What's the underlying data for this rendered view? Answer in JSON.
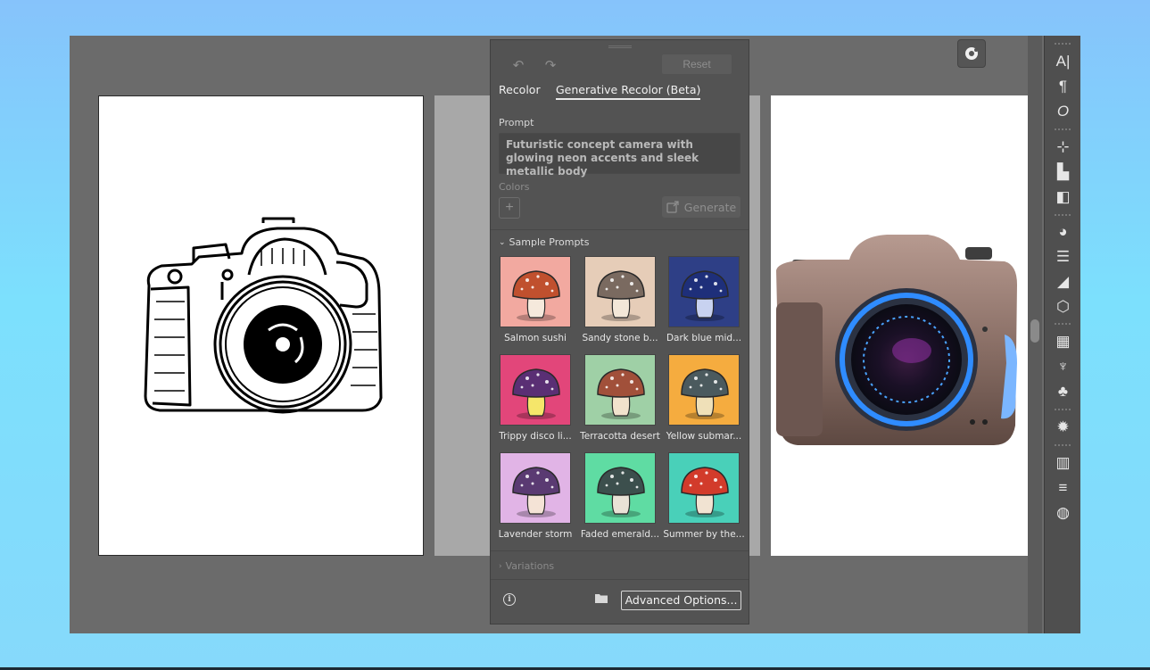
{
  "panel": {
    "reset_label": "Reset",
    "tabs": [
      {
        "label": "Recolor"
      },
      {
        "label": "Generative Recolor (Beta)"
      }
    ],
    "prompt_label": "Prompt",
    "prompt_value": "Futuristic concept camera with glowing neon accents and sleek metallic body",
    "colors_label": "Colors",
    "generate_label": "Generate",
    "sample_prompts_label": "Sample Prompts",
    "variations_label": "Variations",
    "advanced_label": "Advanced Options...",
    "info_glyph": "i",
    "samples": [
      {
        "label": "Salmon sushi",
        "bg": "#f2a9a0",
        "cap": "#c0502e",
        "stem": "#f5e9dc"
      },
      {
        "label": "Sandy stone b...",
        "bg": "#e6cdb8",
        "cap": "#7a6a60",
        "stem": "#f3e7d8"
      },
      {
        "label": "Dark blue mid...",
        "bg": "#2e3f86",
        "cap": "#1e2f7a",
        "stem": "#c8d2f0"
      },
      {
        "label": "Trippy disco li...",
        "bg": "#e2467a",
        "cap": "#5a2f74",
        "stem": "#f5e66a"
      },
      {
        "label": "Terracotta desert",
        "bg": "#9fd0a6",
        "cap": "#a1503a",
        "stem": "#f1e2cc"
      },
      {
        "label": "Yellow submar...",
        "bg": "#f5ac3f",
        "cap": "#4b5a5e",
        "stem": "#efe0b8"
      },
      {
        "label": "Lavender storm",
        "bg": "#e1b4e6",
        "cap": "#5a3a72",
        "stem": "#f4e3d6"
      },
      {
        "label": "Faded emerald...",
        "bg": "#5fdca3",
        "cap": "#3c4f4d",
        "stem": "#e9e2d6"
      },
      {
        "label": "Summer by the...",
        "bg": "#49d0b9",
        "cap": "#d23b2b",
        "stem": "#f1e3d2"
      }
    ]
  },
  "toolbar": {
    "items": [
      {
        "name": "character-icon",
        "glyph": "A|"
      },
      {
        "name": "paragraph-icon",
        "glyph": "¶"
      },
      {
        "name": "opentype-icon",
        "glyph": "O"
      },
      {
        "name": "transform-icon",
        "glyph": "⊹"
      },
      {
        "name": "align-icon",
        "glyph": "▙"
      },
      {
        "name": "pathfinder-icon",
        "glyph": "◧"
      },
      {
        "name": "color-palette-icon",
        "glyph": "◕"
      },
      {
        "name": "properties-icon",
        "glyph": "☰"
      },
      {
        "name": "gradient-shape-icon",
        "glyph": "◢"
      },
      {
        "name": "3d-icon",
        "glyph": "⬡"
      },
      {
        "name": "swatches-icon",
        "glyph": "▦"
      },
      {
        "name": "brushes-icon",
        "glyph": "♆"
      },
      {
        "name": "symbols-icon",
        "glyph": "♣"
      },
      {
        "name": "appearance-icon",
        "glyph": "✹"
      },
      {
        "name": "gradient-icon",
        "glyph": "▥"
      },
      {
        "name": "stroke-icon",
        "glyph": "≡"
      },
      {
        "name": "transparency-icon",
        "glyph": "◍"
      }
    ]
  }
}
